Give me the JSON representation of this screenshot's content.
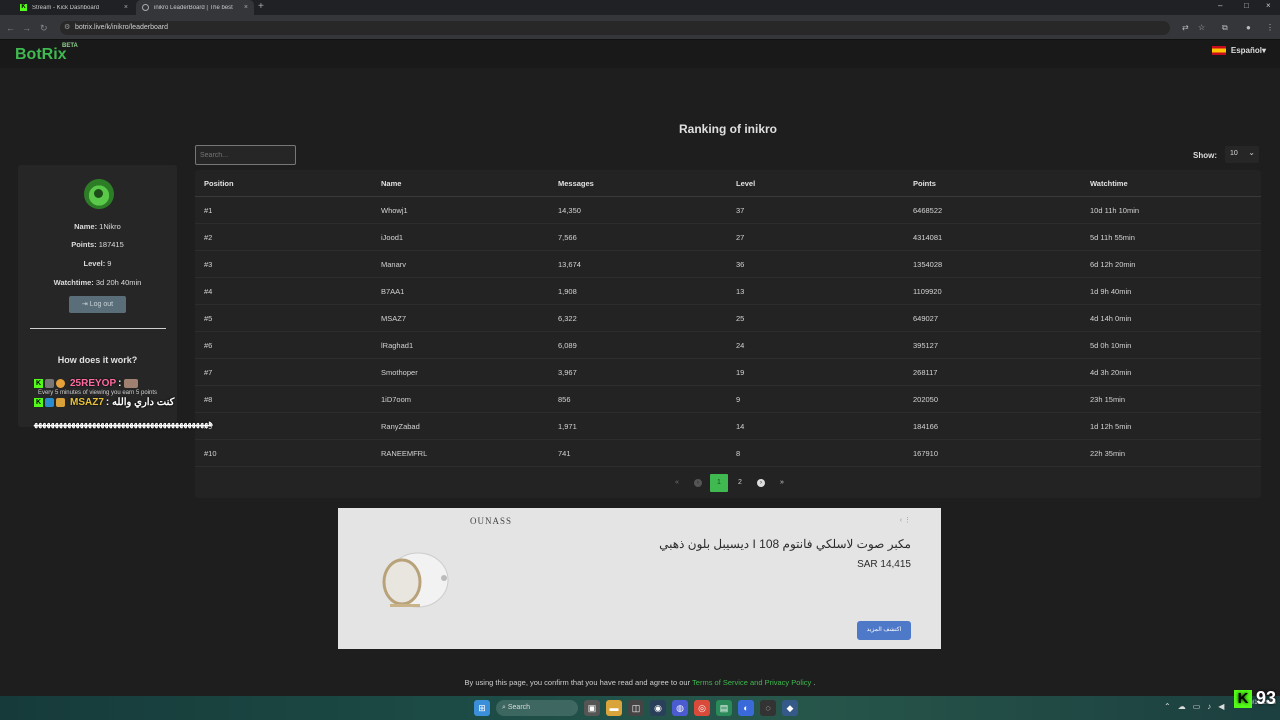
{
  "browser": {
    "tabs": [
      {
        "title": "Stream - Kick Dashboard",
        "close": "×"
      },
      {
        "title": "inikro LeaderBoard | The best",
        "close": "×"
      }
    ],
    "new_tab": "+",
    "window_controls": [
      "–",
      "□",
      "×"
    ],
    "url": "botrix.live/k/inikro/leaderboard"
  },
  "site": {
    "logo": "BotRix",
    "logo_badge": "BETA",
    "language": "Español",
    "language_chevron": "▾"
  },
  "heading": "Ranking of inikro",
  "profile": {
    "name_label": "Name:",
    "name_value": "1Nikro",
    "points_label": "Points:",
    "points_value": "187415",
    "level_label": "Level:",
    "level_value": "9",
    "watchtime_label": "Watchtime:",
    "watchtime_value": "3d 20h 40min",
    "logout_label": "Log out",
    "how_title": "How does it work?",
    "how_text": "Every 5 minutes of viewing you earn 5 points"
  },
  "search": {
    "placeholder": "Search..."
  },
  "show": {
    "label": "Show:",
    "value": "10"
  },
  "table": {
    "columns": [
      "Position",
      "Name",
      "Messages",
      "Level",
      "Points",
      "Watchtime"
    ],
    "rows": [
      [
        "#1",
        "Whowj1",
        "14,350",
        "37",
        "6468522",
        "10d 11h 10min"
      ],
      [
        "#2",
        "iJood1",
        "7,566",
        "27",
        "4314081",
        "5d 11h 55min"
      ],
      [
        "#3",
        "Manarv",
        "13,674",
        "36",
        "1354028",
        "6d 12h 20min"
      ],
      [
        "#4",
        "B7AA1",
        "1,908",
        "13",
        "1109920",
        "1d 9h 40min"
      ],
      [
        "#5",
        "MSAZ7",
        "6,322",
        "25",
        "649027",
        "4d 14h 0min"
      ],
      [
        "#6",
        "lRaghad1",
        "6,089",
        "24",
        "395127",
        "5d 0h 10min"
      ],
      [
        "#7",
        "Smothoper",
        "3,967",
        "19",
        "268117",
        "4d 3h 20min"
      ],
      [
        "#8",
        "1iD7oom",
        "856",
        "9",
        "202050",
        "23h 15min"
      ],
      [
        "#9",
        "RanyZabad",
        "1,971",
        "14",
        "184166",
        "1d 12h 5min"
      ],
      [
        "#10",
        "RANEEMFRL",
        "741",
        "8",
        "167910",
        "22h 35min"
      ]
    ]
  },
  "pagination": {
    "first": "«",
    "prev": "‹",
    "pages": [
      "1",
      "2"
    ],
    "next": "›",
    "last": "»"
  },
  "ad": {
    "brand": "OUNASS",
    "title": "مكبر صوت لاسلكي فانتوم I 108 ديسيبل بلون ذهبي",
    "price": "SAR 14,415",
    "cta": "اكتشف المزيد",
    "controls": "‹ ⋮"
  },
  "footer": {
    "text_before": "By using this page, you confirm that you have read and agree to our",
    "link": "Terms of Service and Privacy Policy",
    "text_after": "."
  },
  "overlay": {
    "chat1_user": "25REYOP",
    "chat1_sep": ":",
    "chat2_user": "MSAZ7",
    "chat2_msg": ": كنت داري والله",
    "spam": "ﻫﻬﻬﻬﻬﻬﻬﻬﻬﻬﻬﻬﻬﻬﻬﻬﻬﻬﻬﻬﻬﻬﻬﻬﻬﻬﻬﻬﻬﻬﻬﻬﻬﻬﻬﻬﻬﻬﻬﻬﻬﻬﻬ",
    "kick_count": "93",
    "kick_letter": "K"
  },
  "taskbar": {
    "search": "Search",
    "date": "10/15/2025"
  },
  "colors": {
    "accent": "#3fb950",
    "kick": "#53fc18",
    "background": "#1e1e1e"
  }
}
